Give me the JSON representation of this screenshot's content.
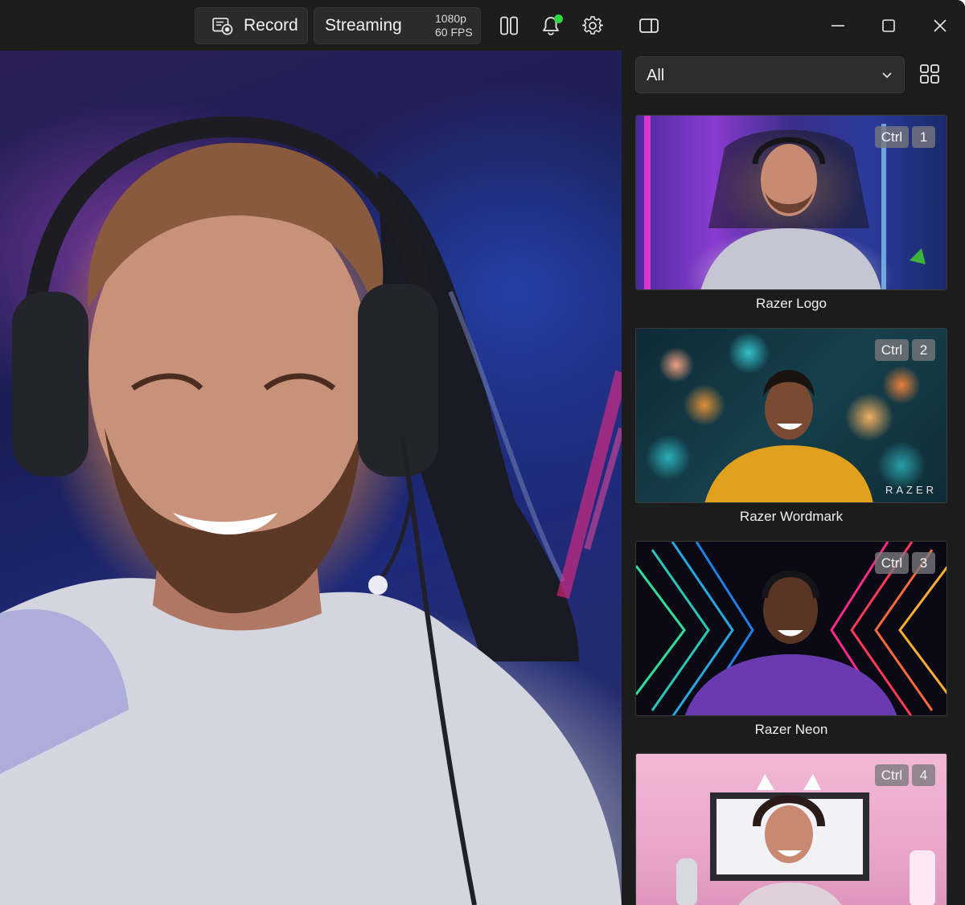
{
  "titlebar": {
    "record_label": "Record",
    "streaming_label": "Streaming",
    "resolution": "1080p",
    "fps": "60 FPS",
    "icons": [
      "record-icon",
      "layout-columns-icon",
      "notification-bell-icon",
      "settings-gear-icon",
      "sidebar-panel-icon",
      "minimize-icon",
      "maximize-icon",
      "close-icon"
    ],
    "notification_dot_color": "#31d843"
  },
  "panel": {
    "filter": {
      "selected": "All"
    },
    "view_toggle_icon": "grid-view-icon",
    "scenes": [
      {
        "name": "Razer Logo",
        "modifier": "Ctrl",
        "key": "1"
      },
      {
        "name": "Razer Wordmark",
        "modifier": "Ctrl",
        "key": "2",
        "watermark": "RAZER"
      },
      {
        "name": "Razer Neon",
        "modifier": "Ctrl",
        "key": "3"
      },
      {
        "name": "",
        "modifier": "Ctrl",
        "key": "4"
      }
    ]
  }
}
